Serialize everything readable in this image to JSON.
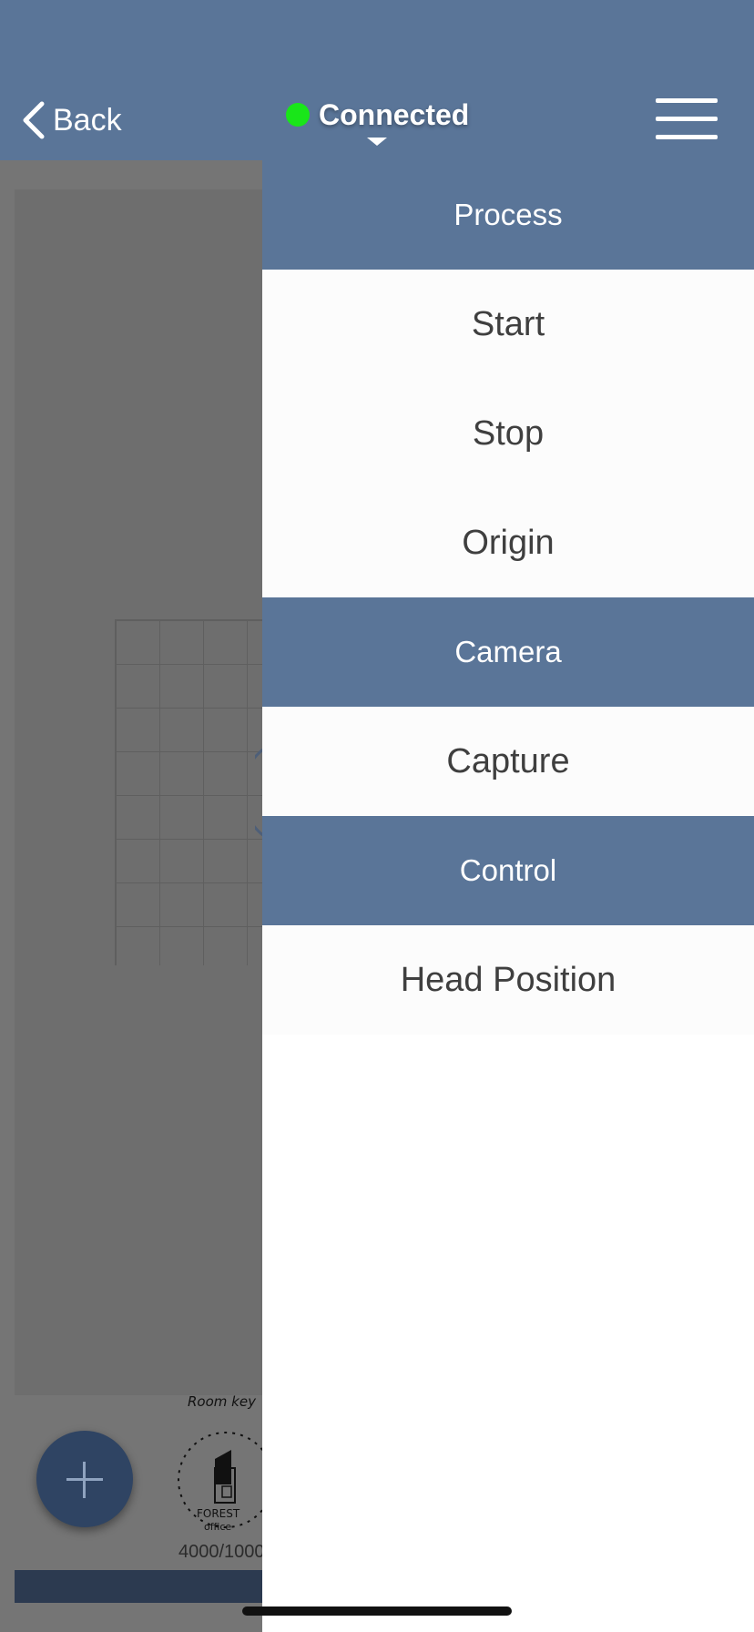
{
  "header": {
    "back_label": "Back",
    "status_text": "Connected",
    "status_color": "#19e619"
  },
  "menu": {
    "sections": [
      {
        "title": "Process",
        "items": [
          "Start",
          "Stop",
          "Origin"
        ]
      },
      {
        "title": "Camera",
        "items": [
          "Capture"
        ]
      },
      {
        "title": "Control",
        "items": [
          "Head Position"
        ]
      }
    ]
  },
  "canvas": {
    "thumbnail_caption": "4000/1000"
  },
  "colors": {
    "header_bg": "#5a7598",
    "section_bg": "#5a7598",
    "item_bg": "#fcfcfc"
  }
}
